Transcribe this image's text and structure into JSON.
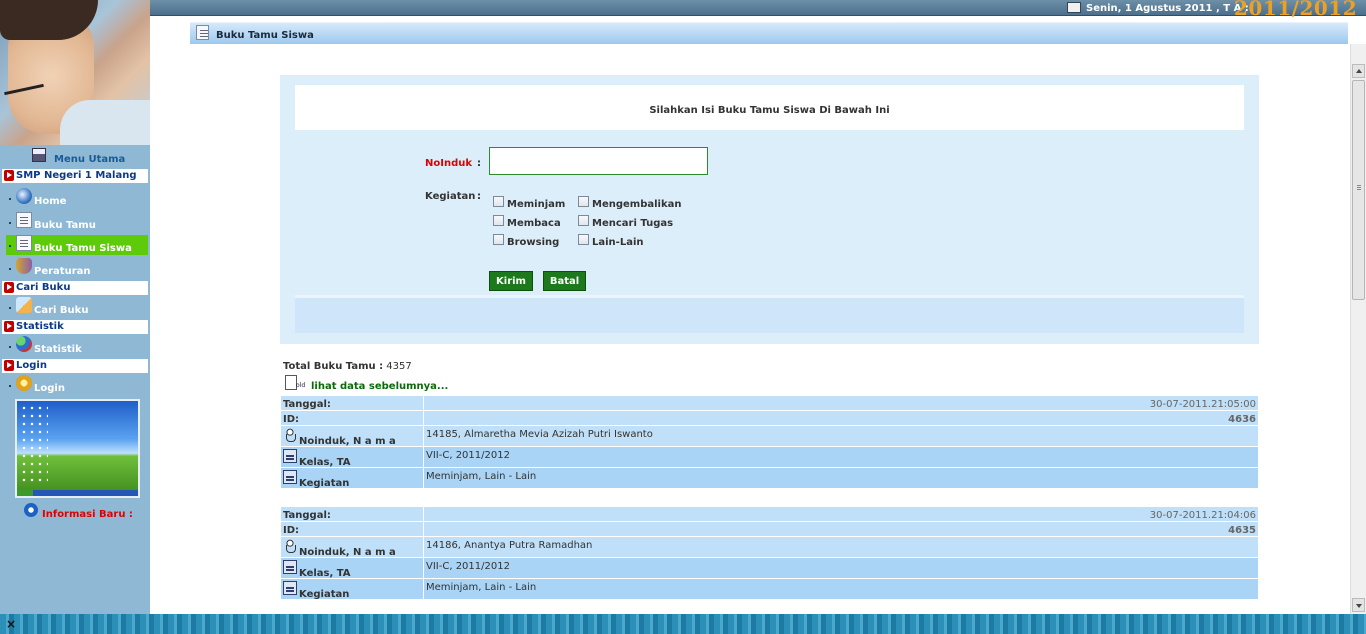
{
  "topbar": {
    "date": "Senin, 1 Agustus 2011 , T A :",
    "ta": "2011/2012"
  },
  "page_title": "Buku Tamu Siswa",
  "sidebar": {
    "menu_title": "Menu Utama",
    "sections": [
      {
        "label": "SMP Negeri 1 Malang",
        "items": [
          {
            "label": "Home",
            "icon": "home-icon"
          },
          {
            "label": "Buku Tamu",
            "icon": "page-icon"
          },
          {
            "label": "Buku Tamu Siswa",
            "icon": "page-icon",
            "active": true
          },
          {
            "label": "Peraturan",
            "icon": "shield-icon"
          }
        ]
      },
      {
        "label": "Cari Buku",
        "items": [
          {
            "label": "Cari Buku",
            "icon": "search-icon"
          }
        ]
      },
      {
        "label": "Statistik",
        "items": [
          {
            "label": "Statistik",
            "icon": "statistics-icon"
          }
        ]
      },
      {
        "label": "Login",
        "items": [
          {
            "label": "Login",
            "icon": "login-icon"
          }
        ]
      }
    ],
    "info_baru": "Informasi Baru :"
  },
  "form": {
    "heading": "Silahkan Isi Buku Tamu Siswa Di Bawah Ini",
    "noinduk_label": "NoInduk",
    "colon": ":",
    "noinduk_value": "",
    "kegiatan_label": "Kegiatan",
    "checkboxes": [
      "Meminjam",
      "Mengembalikan",
      "Membaca",
      "Mencari Tugas",
      "Browsing",
      "Lain-Lain"
    ],
    "submit_label": "Kirim",
    "cancel_label": "Batal"
  },
  "list": {
    "total_label": "Total Buku Tamu :",
    "total_value": "4357",
    "prev_link": "lihat data sebelumnya...",
    "field_labels": {
      "tanggal": "Tanggal:",
      "id": "ID:",
      "noinduk_nama": "Noinduk, N a m a",
      "kelas": "Kelas, TA",
      "kegiatan": "Kegiatan"
    },
    "entries": [
      {
        "tanggal": "30-07-2011.21:05:00",
        "id": "4636",
        "noinduk_nama": "14185, Almaretha Mevia Azizah Putri Iswanto",
        "kelas": "VII-C, 2011/2012",
        "kegiatan": "Meminjam, Lain - Lain"
      },
      {
        "tanggal": "30-07-2011.21:04:06",
        "id": "4635",
        "noinduk_nama": "14186, Anantya Putra Ramadhan",
        "kelas": "VII-C, 2011/2012",
        "kegiatan": "Meminjam, Lain - Lain"
      }
    ]
  }
}
